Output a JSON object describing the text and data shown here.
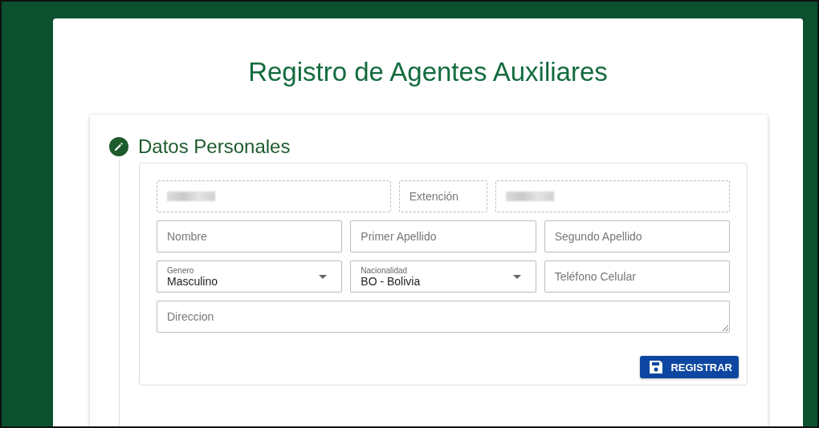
{
  "page_title": "Registro de Agentes Auxiliares",
  "section": {
    "title": "Datos Personales",
    "rows": [
      [
        {
          "kind": "redacted",
          "disabled": true
        },
        {
          "kind": "text",
          "placeholder": "Extención",
          "disabled": true
        },
        {
          "kind": "redacted",
          "disabled": true
        }
      ],
      [
        {
          "kind": "text",
          "placeholder": "Nombre",
          "disabled": false
        },
        {
          "kind": "text",
          "placeholder": "Primer Apellido",
          "disabled": false
        },
        {
          "kind": "text",
          "placeholder": "Segundo Apellido",
          "disabled": false
        }
      ],
      [
        {
          "kind": "select",
          "label": "Genero",
          "value": "Masculino",
          "disabled": false
        },
        {
          "kind": "select",
          "label": "Nacionalidad",
          "value": "BO - Bolivia",
          "disabled": false
        },
        {
          "kind": "text",
          "placeholder": "Teléfono Celular",
          "disabled": false
        }
      ],
      [
        {
          "kind": "textarea",
          "placeholder": "Direccion",
          "disabled": false
        }
      ]
    ]
  },
  "button": {
    "label": "REGISTRAR"
  }
}
